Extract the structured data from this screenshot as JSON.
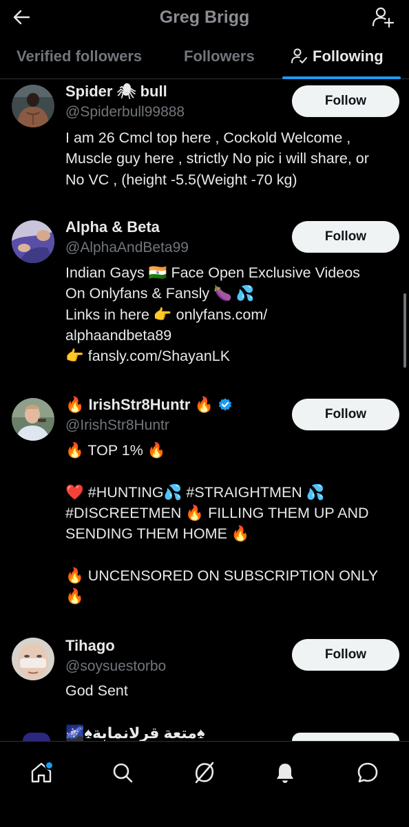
{
  "header": {
    "title": "Greg Brigg",
    "back_icon": "arrow-left-icon",
    "action_icon": "add-person-icon"
  },
  "tabs": [
    {
      "label": "Verified followers",
      "active": false
    },
    {
      "label": "Followers",
      "active": false
    },
    {
      "label": "Following",
      "active": true,
      "icon": "person-check-icon"
    }
  ],
  "accent_color": "#1d9bf0",
  "users": [
    {
      "name": "Spider 🕷 bull",
      "handle": "@Spiderbull99888",
      "verified": false,
      "follow_label": "Follow",
      "bio": "I am 26 Cmcl top here , Cockold Welcome ,\nMuscle guy here , strictly No pic i will share, or\nNo VC , (height -5.5(Weight -70 kg)"
    },
    {
      "name": "Alpha & Beta",
      "handle": "@AlphaAndBeta99",
      "verified": false,
      "follow_label": "Follow",
      "bio": "Indian Gays 🇮🇳 Face Open Exclusive Videos\nOn Onlyfans & Fansly 🍆 💦\nLinks in here 👉 onlyfans.com/\nalphaandbeta89\n👉 fansly.com/ShayanLK"
    },
    {
      "name": "🔥 IrishStr8Huntr 🔥",
      "handle": "@IrishStr8Huntr",
      "verified": true,
      "follow_label": "Follow",
      "bio": "🔥 TOP 1% 🔥\n\n❤️ #HUNTING💦 #STRAIGHTMEN 💦\n#DISCREETMEN 🔥 FILLING THEM UP AND\nSENDING THEM HOME 🔥\n\n🔥 UNCENSORED ON SUBSCRIPTION ONLY\n🔥"
    },
    {
      "name": "Tihago",
      "handle": "@soysuestorbo",
      "verified": false,
      "follow_label": "Follow",
      "bio": "God Sent"
    }
  ],
  "partial_user": {
    "name": "🌌♠متعة قرلانمابة♠"
  },
  "nav": [
    {
      "icon": "home-icon",
      "has_dot": true
    },
    {
      "icon": "search-icon"
    },
    {
      "icon": "grok-icon"
    },
    {
      "icon": "bell-icon"
    },
    {
      "icon": "chat-icon"
    }
  ]
}
